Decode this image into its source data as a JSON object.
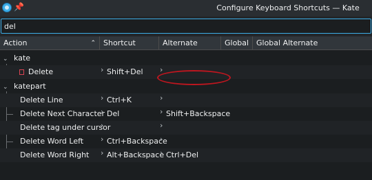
{
  "window": {
    "title": "Configure Keyboard Shortcuts — Kate"
  },
  "search": {
    "value": "del"
  },
  "columns": [
    "Action",
    "Shortcut",
    "Alternate",
    "Global",
    "Global Alternate"
  ],
  "groups": [
    {
      "name": "kate",
      "items": [
        {
          "action": "Delete",
          "shortcut": "Shift+Del",
          "alternate": ""
        }
      ]
    },
    {
      "name": "katepart",
      "items": [
        {
          "action": "Delete Line",
          "shortcut": "Ctrl+K",
          "alternate": ""
        },
        {
          "action": "Delete Next Character",
          "shortcut": "Del",
          "alternate": "Shift+Backspace"
        },
        {
          "action": "Delete tag under cursor",
          "shortcut": "",
          "alternate": ""
        },
        {
          "action": "Delete Word Left",
          "shortcut": "Ctrl+Backspace",
          "alternate": ""
        },
        {
          "action": "Delete Word Right",
          "shortcut": "Alt+Backspace",
          "alternate": "Ctrl+Del"
        }
      ]
    }
  ],
  "colors": {
    "accent": "#3daee9",
    "highlight_ring": "#c0161f"
  }
}
